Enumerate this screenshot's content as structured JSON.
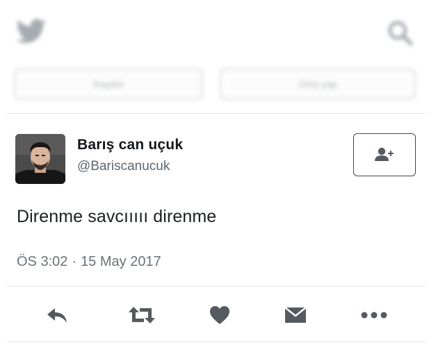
{
  "top_bar": {
    "left_button_label": "Kaydol",
    "right_button_label": "Giriş yap"
  },
  "tweet": {
    "display_name": "Barış can uçuk",
    "handle": "@Bariscanucuk",
    "text": "Direnme savcııııı direnme",
    "time": "ÖS 3:02",
    "separator": "·",
    "date": "15 May 2017"
  },
  "icons": {
    "logo": "twitter-bird-icon",
    "search": "search-icon",
    "follow": "follow-user-icon",
    "reply": "reply-icon",
    "retweet": "retweet-icon",
    "like": "heart-icon",
    "message": "direct-message-icon",
    "more": "more-icon"
  },
  "colors": {
    "text": "#14171a",
    "muted": "#6b7278",
    "icon": "#545a60"
  }
}
